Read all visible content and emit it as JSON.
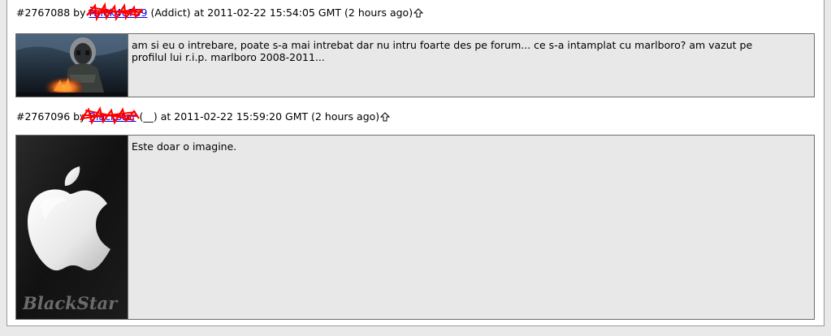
{
  "posts": [
    {
      "id": "#2767088",
      "by": "by",
      "username": "Hn6k4e759",
      "rank": "(Addict)",
      "at": "at",
      "timestamp": "2011-02-22 15:54:05 GMT",
      "relative": "(2 hours ago)",
      "message": "am si eu o intrebare, poate s-a mai intrebat dar nu intru foarte des pe forum... ce s-a intamplat cu marlboro? am vazut pe profilul lui r.i.p. marlboro 2008-2011..."
    },
    {
      "id": "#2767096",
      "by": "by",
      "username": "Blackstar",
      "rank": "(__)",
      "at": "at",
      "timestamp": "2011-02-22 15:59:20 GMT",
      "relative": "(2 hours ago)",
      "message": "Este doar o imagine.",
      "avatar_caption": "BlackStar"
    }
  ],
  "icons": {
    "up_arrow": "up-arrow-icon"
  },
  "colors": {
    "link": "#0000ee",
    "redaction": "#ff0000",
    "post_bg": "#e8e8e8"
  }
}
